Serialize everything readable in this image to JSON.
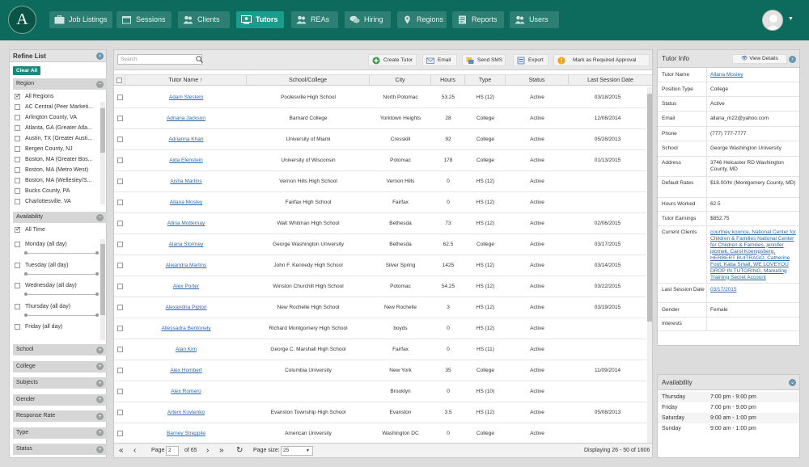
{
  "app": {
    "logo_letter": "A"
  },
  "nav": [
    {
      "label": "Job Listings",
      "icon": "briefcase-icon",
      "active": false
    },
    {
      "label": "Sessions",
      "icon": "calendar-icon",
      "active": false
    },
    {
      "label": "Clients",
      "icon": "users-icon",
      "active": false
    },
    {
      "label": "Tutors",
      "icon": "tutors-icon",
      "active": true
    },
    {
      "label": "REAs",
      "icon": "users-icon",
      "active": false
    },
    {
      "label": "Hiring",
      "icon": "chat-icon",
      "active": false
    },
    {
      "label": "Regions",
      "icon": "map-pin-icon",
      "active": false
    },
    {
      "label": "Reports",
      "icon": "report-icon",
      "active": false
    },
    {
      "label": "Users",
      "icon": "users-icon",
      "active": false
    }
  ],
  "refine": {
    "title": "Refine List",
    "clear_all": "Clear All",
    "region_title": "Region",
    "regions": [
      {
        "label": "All Regions",
        "checked": true
      },
      {
        "label": "AC Central (Peer Marketi...",
        "checked": false
      },
      {
        "label": "Arlington County, VA",
        "checked": false
      },
      {
        "label": "Atlanta, GA (Greater Atla...",
        "checked": false
      },
      {
        "label": "Austin, TX (Greater Austi...",
        "checked": false
      },
      {
        "label": "Bergen County, NJ",
        "checked": false
      },
      {
        "label": "Boston, MA (Greater Bos...",
        "checked": false
      },
      {
        "label": "Boston, MA (Metro West)",
        "checked": false
      },
      {
        "label": "Boston, MA (Wellesley/S...",
        "checked": false
      },
      {
        "label": "Bucks County, PA",
        "checked": false
      },
      {
        "label": "Charlottesville, VA",
        "checked": false
      }
    ],
    "availability_title": "Availability",
    "all_time": "All Time",
    "days": [
      "Monday (all day)",
      "Tuesday (all day)",
      "Wednesday (all day)",
      "Thursday (all day)",
      "Friday (all day)"
    ],
    "sections": [
      "School",
      "College",
      "Subjects",
      "Gender",
      "Response Rate",
      "Type",
      "Status"
    ]
  },
  "toolbar": {
    "search_placeholder": "Search",
    "create_tutor": "Create Tutor",
    "email": "Email",
    "send_sms": "Send SMS",
    "export": "Export",
    "mark_required": "Mark as Required Approval"
  },
  "columns": [
    "Tutor Name ↑",
    "School/College",
    "City",
    "Hours",
    "Type",
    "Status",
    "Last Session Date"
  ],
  "rows": [
    [
      "Adam Stestein",
      "Poolesville High School",
      "North Potomac",
      "53.25",
      "HS (12)",
      "Active",
      "03/18/2015"
    ],
    [
      "Adriana Jackson",
      "Barnard College",
      "Yorktown Heights",
      "28",
      "College",
      "Active",
      "12/08/2014"
    ],
    [
      "Adrianna Khan",
      "University of Miami",
      "Cresskill",
      "92",
      "College",
      "Active",
      "05/28/2013"
    ],
    [
      "Aida Elenstein",
      "University of Wisconsin",
      "Potomac",
      "178",
      "College",
      "Active",
      "01/13/2015"
    ],
    [
      "Aisha Martins",
      "Vernon Hills High School",
      "Vernon Hills",
      "0",
      "HS (12)",
      "Active",
      ""
    ],
    [
      "Allana Mosley",
      "Fairfax High School",
      "Fairfax",
      "0",
      "HS (12)",
      "Active",
      ""
    ],
    [
      "Allina Motternay",
      "Walt Whitman High School",
      "Bethesda",
      "73",
      "HS (12)",
      "Active",
      "02/06/2015"
    ],
    [
      "Alana  Stormey",
      "George Washington University",
      "Bethesda",
      "62.5",
      "College",
      "Active",
      "03/17/2015"
    ],
    [
      "Alejandra Martins",
      "John F. Kennedy High School",
      "Silver Spring",
      "1425",
      "HS (12)",
      "Active",
      "03/14/2015"
    ],
    [
      "Alex Porter",
      "Winston Churchill High School",
      "Potomac",
      "54.25",
      "HS (12)",
      "Active",
      "03/22/2015"
    ],
    [
      "Alexandria Pipton",
      "New Rochelle High School",
      "New Rochelle",
      "3",
      "HS (12)",
      "Active",
      "03/19/2015"
    ],
    [
      "Allessadra Bentonely",
      "Richard Montgomery High School",
      "boyds",
      "0",
      "HS (12)",
      "Active",
      ""
    ],
    [
      "Alan Kim",
      "George C. Marshall High School",
      "Fairfax",
      "0",
      "HS (11)",
      "Active",
      ""
    ],
    [
      "Alex Hombert",
      "Columbia University",
      "New York",
      "35",
      "College",
      "Active",
      "11/09/2014"
    ],
    [
      "Alex Romero",
      "",
      "Brooklyn",
      "0",
      "HS (10)",
      "Active",
      ""
    ],
    [
      "Artem Kovtenko",
      "Evanston Township High School",
      "Evanston",
      "3.5",
      "HS (12)",
      "Active",
      "05/08/2013"
    ],
    [
      "Barney Streppile",
      "American University",
      "Washington DC",
      "0",
      "College",
      "Active",
      ""
    ]
  ],
  "pager": {
    "page_label": "Page",
    "page": "2",
    "of_label": "of 65",
    "size_label": "Page size:",
    "size": "25",
    "displaying": "Displaying 26 - 50 of 1606"
  },
  "info": {
    "title": "Tutor Info",
    "view_details": "View Details",
    "fields": [
      {
        "label": "Tutor Name",
        "value": "Allana Mosley",
        "link": true
      },
      {
        "label": "Position Type",
        "value": "College"
      },
      {
        "label": "Status",
        "value": "Active"
      },
      {
        "label": "Email",
        "value": "allana_m22@yahoo.com"
      },
      {
        "label": "Phone",
        "value": "(777) 777-7777"
      },
      {
        "label": "School",
        "value": "George Washington University"
      },
      {
        "label": "Address",
        "value": "3746 Helcaster RD Washington County, MD"
      },
      {
        "label": "Default Rates",
        "value": "$18.00/hr (Montgomery County, MD)"
      },
      {
        "label": "Hours Worked",
        "value": "62.5"
      },
      {
        "label": "Tutor Earnings",
        "value": "$852.75"
      },
      {
        "label": "Current Clients",
        "value": "courtney koonce, National Center for Children & Families National Center for Children & Families, jennifer plotnek, Carol Koenigsberg, HERBERT BUITRAGO, Catherine Foot, Katia Small, WE LOVEYOU DROP IN TUTORING, Marketing Training Secret Account",
        "link": true
      },
      {
        "label": "Last Session Date",
        "value": "03/17/2015",
        "link": true
      },
      {
        "label": "Gender",
        "value": "Female"
      },
      {
        "label": "Interests",
        "value": ""
      }
    ]
  },
  "availability": {
    "title": "Availability",
    "rows": [
      {
        "day": "Thursday",
        "time": "7:00 pm - 9:00 pm"
      },
      {
        "day": "Friday",
        "time": "7:00 pm - 9:00 pm"
      },
      {
        "day": "Saturday",
        "time": "9:00 am - 1:00 pm"
      },
      {
        "day": "Sunday",
        "time": "9:00 am - 1:00 pm"
      }
    ]
  },
  "colors": {
    "header": "#0d6b5e",
    "nav_active": "#1a9d8c",
    "link": "#2a6aa8"
  }
}
